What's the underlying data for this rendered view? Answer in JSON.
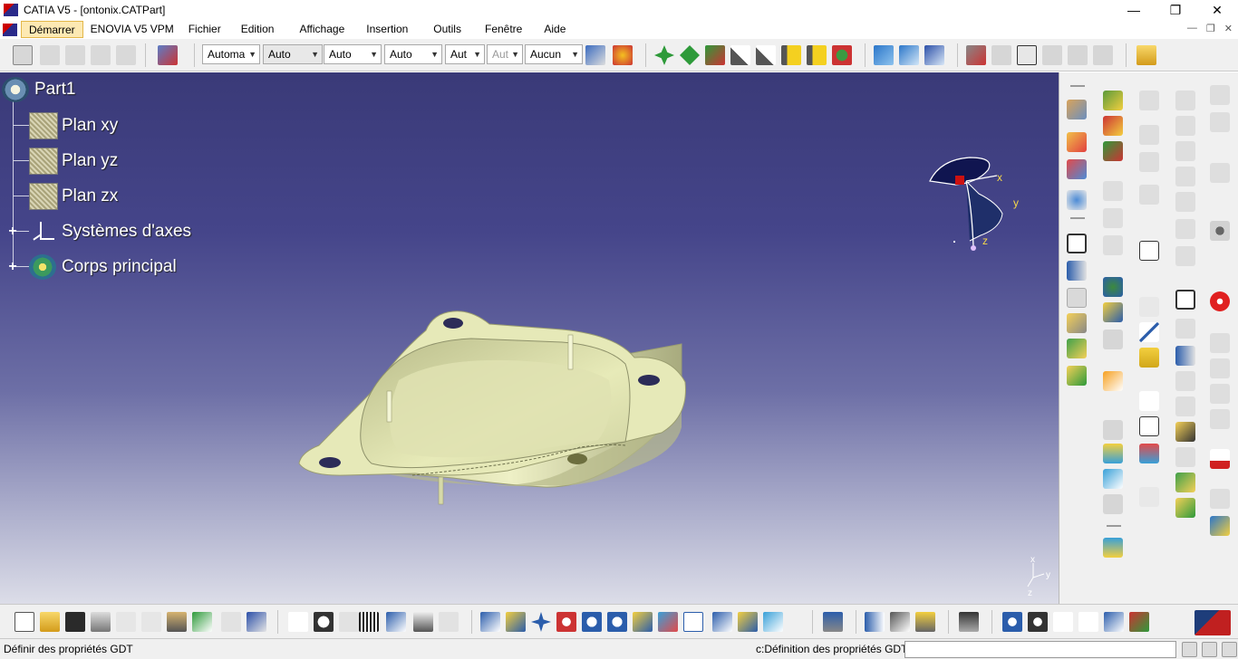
{
  "window": {
    "title": "CATIA V5 - [ontonix.CATPart]",
    "minimize": "—",
    "maximize": "❐",
    "close": "✕"
  },
  "menubar": {
    "items": [
      "Démarrer",
      "ENOVIA V5 VPM",
      "Fichier",
      "Edition",
      "Affichage",
      "Insertion",
      "Outils",
      "Fenêtre",
      "Aide"
    ],
    "doc_controls": [
      "—",
      "❐",
      "✕"
    ]
  },
  "toolbar": {
    "combos": [
      "Automa",
      "Auto",
      "Auto",
      "Auto",
      "Aut",
      "Aut",
      "Aucun"
    ]
  },
  "tree": {
    "root": "Part1",
    "items": [
      "Plan xy",
      "Plan yz",
      "Plan zx",
      "Systèmes d'axes",
      "Corps principal"
    ]
  },
  "compass": {
    "x": "x",
    "y": "y",
    "z": "z"
  },
  "mini_axes": {
    "x": "x",
    "y": "y",
    "z": "z"
  },
  "status": {
    "left": "Définir des propriétés GDT",
    "right": "c:Définition des propriétés GDT"
  },
  "colors": {
    "part_fill": "#e3e6b4",
    "part_shadow": "#a5a87a",
    "bg_top": "#3a3a78",
    "bg_bottom": "#dcdde8"
  }
}
